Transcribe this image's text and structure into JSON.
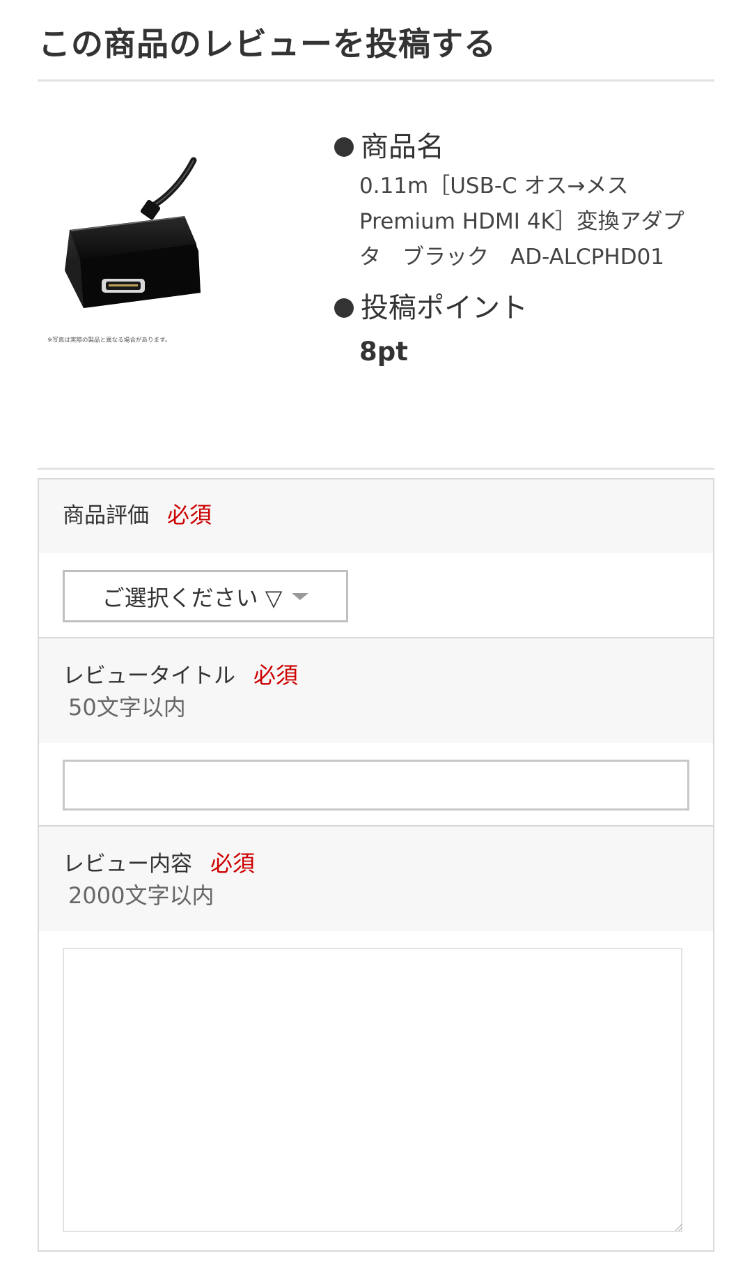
{
  "page": {
    "title": "この商品のレビューを投稿する"
  },
  "product": {
    "image_caption": "※写真は実際の製品と異なる場合があります。",
    "name_label": "商品名",
    "name_value": "0.11m［USB-C オス→メス Premium HDMI 4K］変換アダプタ　ブラック　AD-ALCPHD01",
    "points_label": "投稿ポイント",
    "points_value": "8pt"
  },
  "form": {
    "rating": {
      "label": "商品評価",
      "required": "必須",
      "select_value": "ご選択ください ▽"
    },
    "title": {
      "label": "レビュータイトル",
      "required": "必須",
      "note": "50文字以内",
      "value": ""
    },
    "content": {
      "label": "レビュー内容",
      "required": "必須",
      "note": "2000文字以内",
      "value": ""
    }
  },
  "colors": {
    "required": "#cc0000",
    "text": "#333333",
    "row_background": "#f7f7f7",
    "border": "#d8d8d8"
  },
  "icons": {
    "bullet": "bullet-dot-icon",
    "select_caret": "caret-down-icon"
  }
}
